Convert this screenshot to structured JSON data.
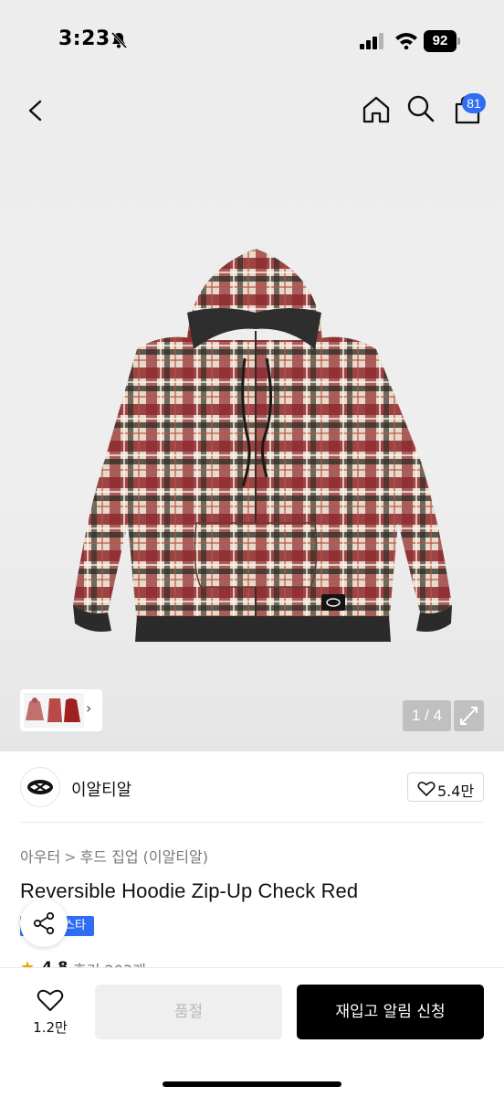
{
  "status_bar": {
    "time": "3:23",
    "battery": "92"
  },
  "nav": {
    "cart_count": "81"
  },
  "gallery": {
    "counter": "1 / 4",
    "thumb_more": "›"
  },
  "brand": {
    "name": "이알티알",
    "likes": "5.4만"
  },
  "product": {
    "breadcrumb": [
      "아우터",
      "후드 집업 (이알티알)"
    ],
    "breadcrumb_separator": ">",
    "title": "Reversible Hoodie Zip-Up Check Red",
    "tag": "스타",
    "rating": "4.8",
    "review": "후기 203개"
  },
  "bottom_bar": {
    "wish_count": "1.2만",
    "soldout_label": "품절",
    "restock_label": "재입고 알림 신청"
  },
  "colors": {
    "accent": "#2f6ef2",
    "star": "#f0a400",
    "primary_button": "#000000",
    "disabled_button": "#efefef"
  },
  "icons": {
    "nav_back": "chevron-left-icon",
    "nav_home": "home-icon",
    "nav_search": "search-icon",
    "nav_cart": "shopping-bag-icon",
    "share": "share-icon",
    "like": "heart-icon",
    "expand": "expand-icon"
  }
}
